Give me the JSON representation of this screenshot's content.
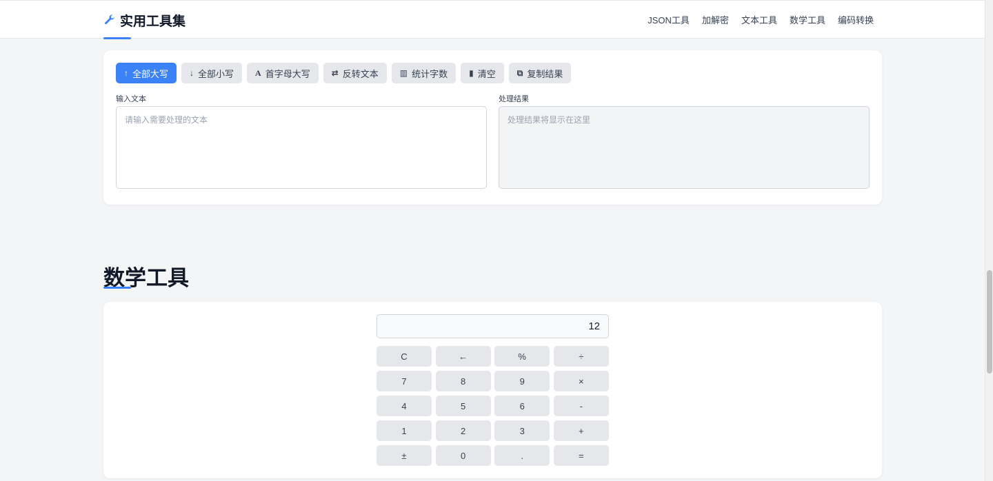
{
  "header": {
    "brand": "实用工具集",
    "nav": [
      "JSON工具",
      "加解密",
      "文本工具",
      "数学工具",
      "编码转换"
    ]
  },
  "text_tool": {
    "buttons": [
      {
        "icon": "arrow-up-icon",
        "glyph": "🡑",
        "label": "全部大写",
        "active": true
      },
      {
        "icon": "arrow-down-icon",
        "glyph": "🡓",
        "label": "全部小写",
        "active": false
      },
      {
        "icon": "font-icon",
        "glyph": "A",
        "label": "首字母大写",
        "active": false
      },
      {
        "icon": "swap-icon",
        "glyph": "⇄",
        "label": "反转文本",
        "active": false
      },
      {
        "icon": "bar-chart-icon",
        "glyph": "▥",
        "label": "统计字数",
        "active": false
      },
      {
        "icon": "trash-icon",
        "glyph": "🗑",
        "label": "清空",
        "active": false
      },
      {
        "icon": "copy-icon",
        "glyph": "⧉",
        "label": "复制结果",
        "active": false
      }
    ],
    "input_label": "输入文本",
    "input_placeholder": "请输入需要处理的文本",
    "output_label": "处理结果",
    "output_placeholder": "处理结果将显示在这里"
  },
  "math_section": {
    "title": "数学工具",
    "display": "12",
    "keys": [
      "C",
      "←",
      "%",
      "÷",
      "7",
      "8",
      "9",
      "×",
      "4",
      "5",
      "6",
      "-",
      "1",
      "2",
      "3",
      "+",
      "±",
      "0",
      ".",
      "="
    ]
  },
  "colors": {
    "accent": "#3b82f6",
    "button_bg": "#e5e7eb",
    "page_bg": "#f4f5f7"
  }
}
